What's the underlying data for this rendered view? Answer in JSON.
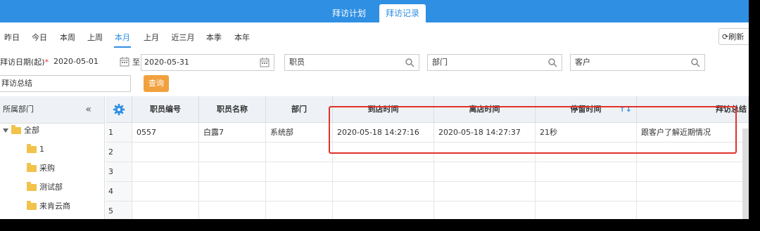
{
  "topnav": {
    "tabs": [
      {
        "label": "拜访计划",
        "active": false
      },
      {
        "label": "拜访记录",
        "active": true
      }
    ],
    "accent_color": "#2f8fe3"
  },
  "periods": [
    "昨日",
    "今日",
    "本周",
    "上周",
    "本月",
    "上月",
    "近三月",
    "本季",
    "本年"
  ],
  "period_active": "本月",
  "refresh_label": "刷新",
  "filters": {
    "date_label": "拜访日期(起)",
    "required_mark": "*",
    "start_date": "2020-05-01",
    "to_label": "至",
    "end_date": "2020-05-31",
    "employee_placeholder": "职员",
    "department_placeholder": "部门",
    "customer_placeholder": "客户",
    "summary_placeholder": "拜访总结",
    "query_label": "查询"
  },
  "tree": {
    "header": "所属部门",
    "collapse_icon": "double-chevron-left-icon",
    "root": "全部",
    "children": [
      "1",
      "采购",
      "测试部",
      "来肯云商"
    ]
  },
  "grid": {
    "settings_icon": "gear-icon",
    "columns": [
      "职员编号",
      "职员名称",
      "部门",
      "到店时间",
      "离店时间",
      "停留时间",
      "拜访总结"
    ],
    "sort_icon": "sort-icon",
    "rows": [
      {
        "num": "1",
        "code": "0557",
        "name": "白露7",
        "dept": "系统部",
        "arrive": "2020-05-18 14:27:16",
        "leave": "2020-05-18 14:27:37",
        "stay": "21秒",
        "summary": "跟客户了解近期情况"
      },
      {
        "num": "2",
        "code": "",
        "name": "",
        "dept": "",
        "arrive": "",
        "leave": "",
        "stay": "",
        "summary": ""
      },
      {
        "num": "3",
        "code": "",
        "name": "",
        "dept": "",
        "arrive": "",
        "leave": "",
        "stay": "",
        "summary": ""
      },
      {
        "num": "4",
        "code": "",
        "name": "",
        "dept": "",
        "arrive": "",
        "leave": "",
        "stay": "",
        "summary": ""
      },
      {
        "num": "5",
        "code": "",
        "name": "",
        "dept": "",
        "arrive": "",
        "leave": "",
        "stay": "",
        "summary": ""
      }
    ]
  },
  "highlight_color": "#e0322b",
  "query_color": "#f0a13d"
}
